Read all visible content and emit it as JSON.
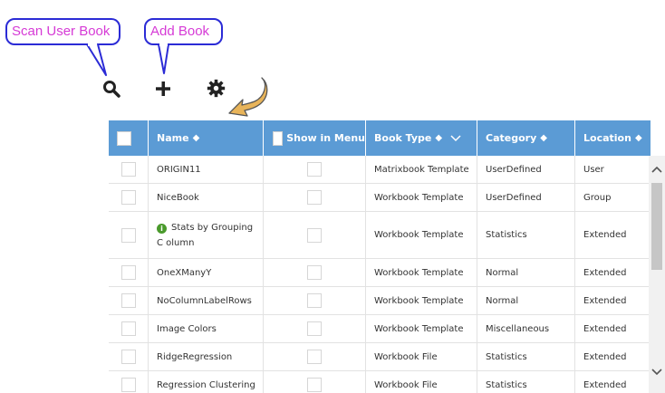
{
  "callouts": {
    "scan": "Scan User Book",
    "add": "Add Book"
  },
  "toolbar": {
    "icons": [
      "search-icon",
      "plus-icon",
      "gear-icon"
    ]
  },
  "colors": {
    "header_bg": "#5b9bd5",
    "callout_border": "#2b2bd6",
    "callout_text": "#d63ad6",
    "arrow_fill": "#e8b45a",
    "info_icon": "#4a9a2c"
  },
  "table": {
    "headers": {
      "name": "Name",
      "show_in_menu": "Show in Menu",
      "book_type": "Book Type",
      "category": "Category",
      "location": "Location",
      "sort_glyph": "◆"
    },
    "rows": [
      {
        "name": "ORIGIN11",
        "book_type": "Matrixbook Template",
        "category": "UserDefined",
        "location": "User"
      },
      {
        "name": "NiceBook",
        "book_type": "Workbook Template",
        "category": "UserDefined",
        "location": "Group"
      },
      {
        "name": "Stats by Grouping C olumn",
        "book_type": "Workbook Template",
        "category": "Statistics",
        "location": "Extended"
      },
      {
        "name": "OneXManyY",
        "book_type": "Workbook Template",
        "category": "Normal",
        "location": "Extended"
      },
      {
        "name": "NoColumnLabelRows",
        "book_type": "Workbook Template",
        "category": "Normal",
        "location": "Extended"
      },
      {
        "name": "Image Colors",
        "book_type": "Workbook Template",
        "category": "Miscellaneous",
        "location": "Extended"
      },
      {
        "name": "RidgeRegression",
        "book_type": "Workbook File",
        "category": "Statistics",
        "location": "Extended"
      },
      {
        "name": "Regression Clustering",
        "book_type": "Workbook File",
        "category": "Statistics",
        "location": "Extended"
      }
    ]
  }
}
